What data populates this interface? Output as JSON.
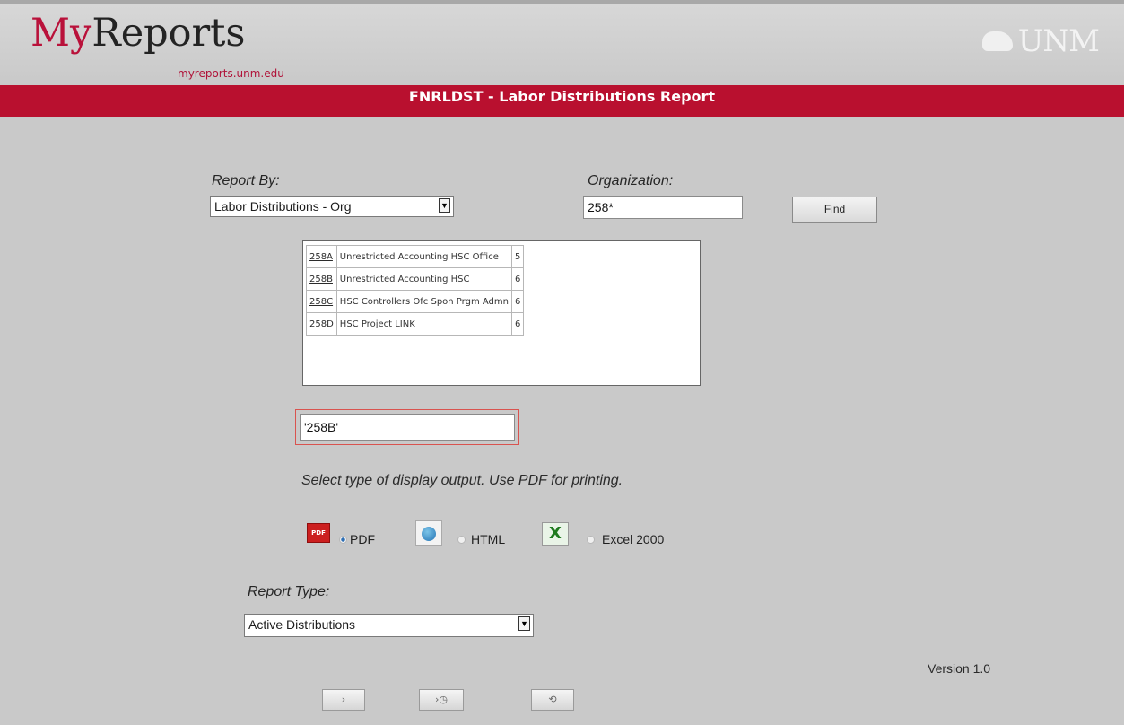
{
  "header": {
    "logo_my": "My",
    "logo_reports": "Reports",
    "logo_url": "myreports.unm.edu",
    "unm_logo": "UNM",
    "report_title": "FNRLDST - Labor Distributions Report",
    "accent_color": "#b9102f"
  },
  "form": {
    "report_by_label": "Report By:",
    "report_by_value": "Labor Distributions - Org",
    "organization_label": "Organization:",
    "organization_value": "258*",
    "find_button": "Find",
    "org_results": [
      {
        "code": "258A",
        "name": "Unrestricted Accounting HSC Office",
        "level": "5"
      },
      {
        "code": "258B",
        "name": "Unrestricted Accounting HSC",
        "level": "6"
      },
      {
        "code": "258C",
        "name": "HSC Controllers Ofc Spon Prgm Admn",
        "level": "6"
      },
      {
        "code": "258D",
        "name": "HSC Project LINK",
        "level": "6"
      }
    ],
    "selected_org": "'258B'",
    "output_instruction": "Select type of display output. Use PDF for printing.",
    "output_options": {
      "pdf_label": "PDF",
      "pdf_icon": "PDF",
      "html_label": "HTML",
      "excel_label": "Excel 2000",
      "excel_icon": "X",
      "selected": "PDF"
    },
    "report_type_label": "Report Type:",
    "report_type_value": "Active Distributions",
    "version": "Version 1.0"
  },
  "nav": {
    "run_icon": "›",
    "schedule_icon": "›◷",
    "back_icon": "⟲"
  }
}
